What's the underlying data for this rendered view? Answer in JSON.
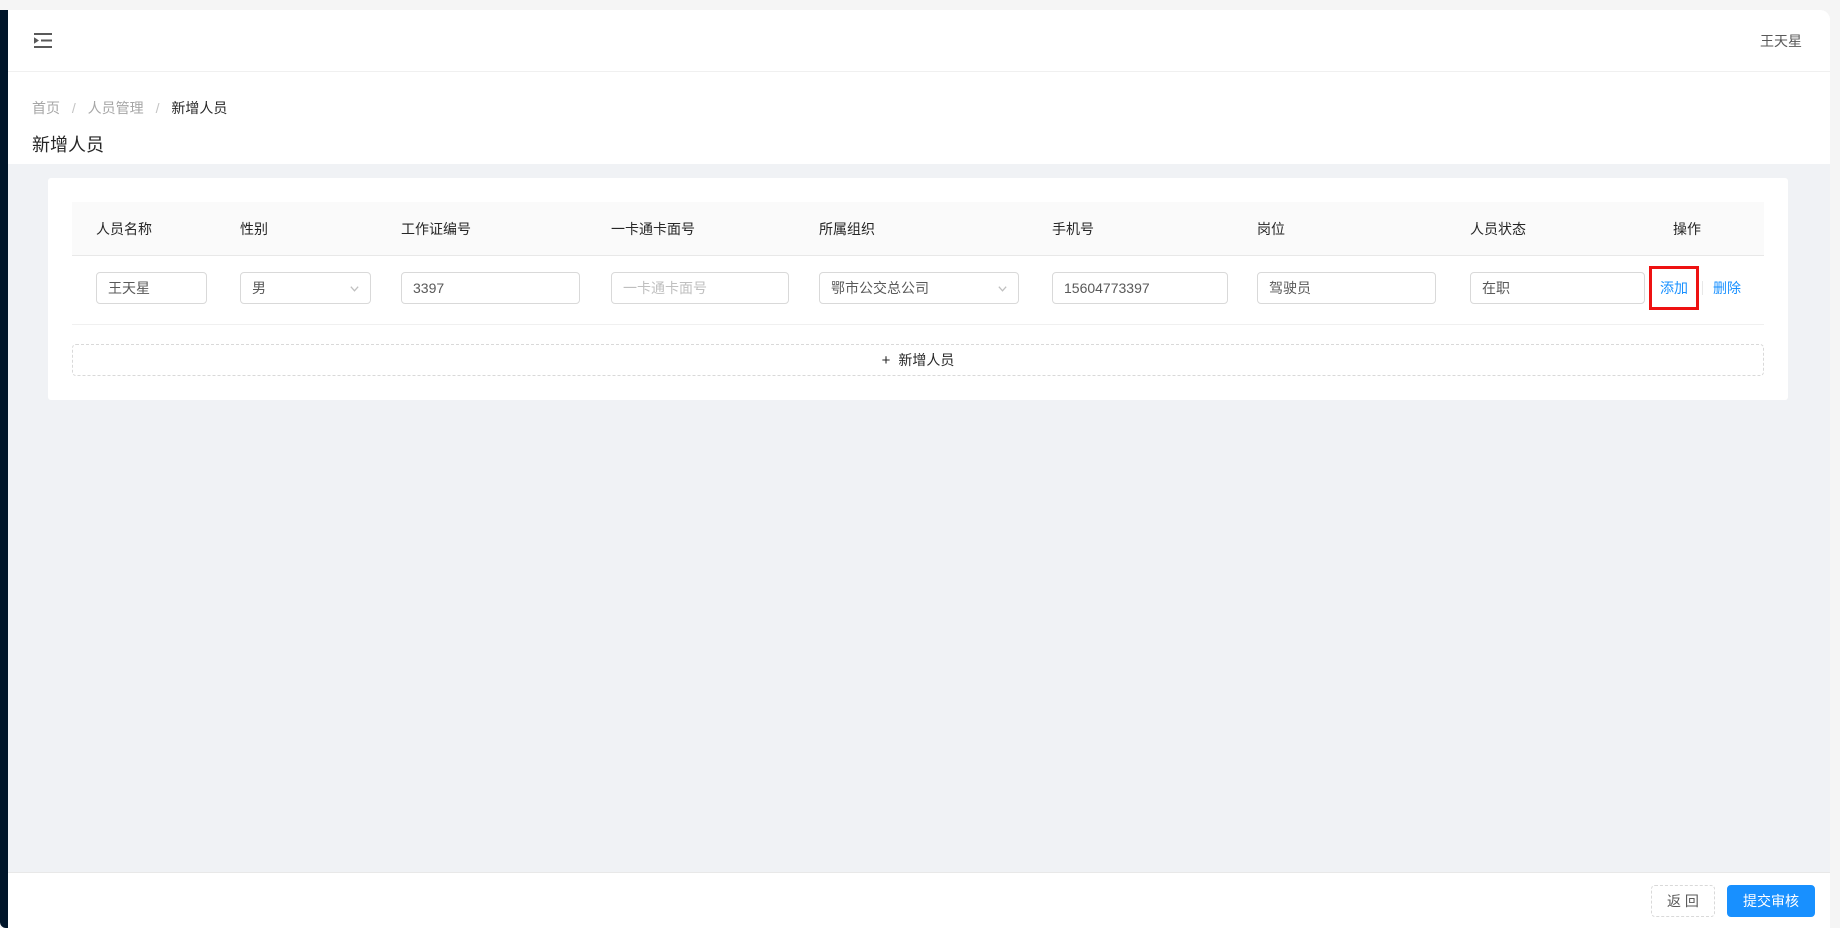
{
  "app": {
    "header": {
      "username": "王天星",
      "collapse_icon": "menu-unfold-icon"
    },
    "breadcrumb": {
      "separator": "/",
      "items": [
        "首页",
        "人员管理",
        "新增人员"
      ]
    },
    "page_title": "新增人员",
    "table": {
      "columns": [
        "人员名称",
        "性别",
        "工作证编号",
        "一卡通卡面号",
        "所属组织",
        "手机号",
        "岗位",
        "人员状态",
        "操作"
      ],
      "row": {
        "name": "王天星",
        "gender": "男",
        "work_id": "3397",
        "card_no_placeholder": "一卡通卡面号",
        "organization": "鄂市公交总公司",
        "phone": "15604773397",
        "position": "驾驶员",
        "status": "在职",
        "action_add": "添加",
        "action_delete": "删除"
      },
      "add_row_label": "新增人员",
      "add_row_plus": "+"
    },
    "footer": {
      "back_label": "返 回",
      "submit_label": "提交审核"
    },
    "colors": {
      "primary": "#1890ff",
      "sidebar": "#001529",
      "annotation_box": "#ee1111",
      "content_bg": "#f0f2f5"
    },
    "icons": {
      "collapse": "menu-unfold-icon",
      "select_arrow": "chevron-down-icon",
      "add": "plus-icon"
    }
  }
}
